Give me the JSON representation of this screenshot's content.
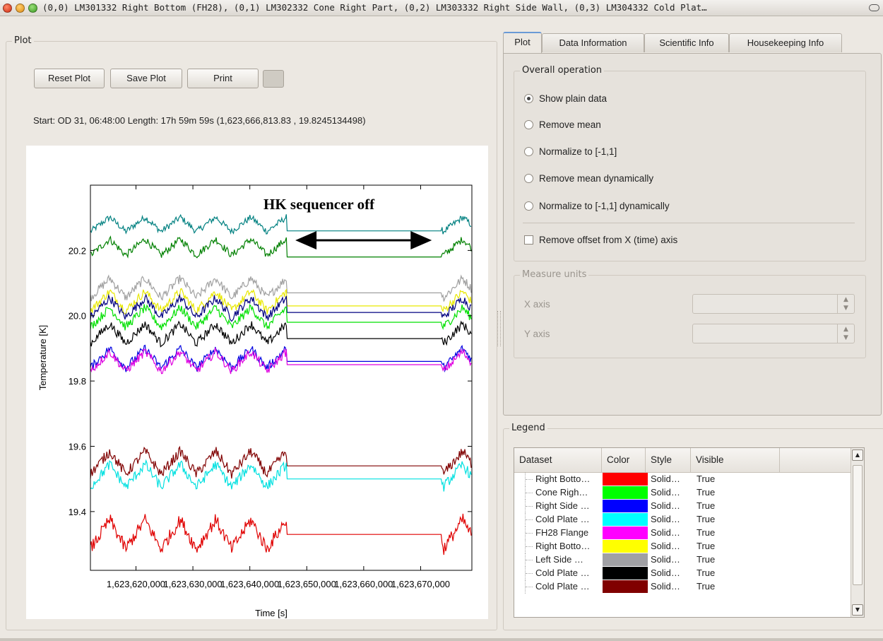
{
  "window": {
    "title": "(0,0) LM301332 Right Bottom (FH28), (0,1) LM302332 Cone Right Part, (0,2) LM303332 Right Side Wall, (0,3) LM304332 Cold Plat…"
  },
  "plot_group": {
    "title": "Plot",
    "buttons": {
      "reset": "Reset Plot",
      "save": "Save Plot",
      "print": "Print"
    },
    "info": "Start: OD 31, 06:48:00  Length: 17h 59m 59s  (1,623,666,813.83 , 19.8245134498)"
  },
  "chart_data": {
    "type": "line",
    "xlabel": "Time [s]",
    "ylabel": "Temperature [K]",
    "xlim": [
      1623612000,
      1623679000
    ],
    "ylim": [
      19.22,
      20.4
    ],
    "x_ticks": [
      1623620000,
      1623630000,
      1623640000,
      1623650000,
      1623660000,
      1623670000
    ],
    "x_tick_labels": [
      "1,623,620,000",
      "1,623,630,000",
      "1,623,640,000",
      "1,623,650,000",
      "1,623,660,000",
      "1,623,670,000"
    ],
    "y_ticks": [
      19.4,
      19.6,
      19.8,
      20.0,
      20.2
    ],
    "y_tick_labels": [
      "19.4",
      "19.6",
      "19.8",
      "20.0",
      "20.2"
    ],
    "gap": [
      1623646500,
      1623673700
    ],
    "annotation": "HK sequencer off",
    "series": [
      {
        "color": "#008080",
        "flat_value": 20.26,
        "amp": 0.022,
        "tilt": 0.02
      },
      {
        "color": "#008000",
        "flat_value": 20.18,
        "amp": 0.025,
        "tilt": 0.03
      },
      {
        "color": "#a0a0a0",
        "flat_value": 20.07,
        "amp": 0.03,
        "tilt": 0.015
      },
      {
        "color": "#e8e800",
        "flat_value": 20.03,
        "amp": 0.03,
        "tilt": 0.015
      },
      {
        "color": "#000080",
        "flat_value": 20.01,
        "amp": 0.03,
        "tilt": 0.015
      },
      {
        "color": "#00e000",
        "flat_value": 19.98,
        "amp": 0.03,
        "tilt": 0.015
      },
      {
        "color": "#000000",
        "flat_value": 19.93,
        "amp": 0.03,
        "tilt": 0.015
      },
      {
        "color": "#0000e0",
        "flat_value": 19.86,
        "amp": 0.03,
        "tilt": 0.01
      },
      {
        "color": "#e000e0",
        "flat_value": 19.85,
        "amp": 0.03,
        "tilt": 0.01
      },
      {
        "color": "#800000",
        "flat_value": 19.54,
        "amp": 0.035,
        "tilt": 0.01
      },
      {
        "color": "#00e0e0",
        "flat_value": 19.5,
        "amp": 0.035,
        "tilt": 0.01
      },
      {
        "color": "#e00000",
        "flat_value": 19.33,
        "amp": 0.045,
        "tilt": 0.0
      }
    ]
  },
  "tabs": [
    "Plot",
    "Data Information",
    "Scientific Info",
    "Housekeeping Info"
  ],
  "overall_operation": {
    "title": "Overall operation",
    "options": [
      "Show plain data",
      "Remove mean",
      "Normalize to [-1,1]",
      "Remove mean dynamically",
      "Normalize to [-1,1] dynamically"
    ],
    "selected": "Show plain data",
    "checkbox_label": "Remove offset from X (time) axis"
  },
  "measure_units": {
    "title": "Measure units",
    "x_label": "X axis",
    "y_label": "Y axis"
  },
  "legend": {
    "title": "Legend",
    "headers": [
      "Dataset",
      "Color",
      "Style",
      "Visible"
    ],
    "rows": [
      {
        "name": "Right Botto…",
        "color": "#ff0000",
        "style": "Solid…",
        "visible": "True"
      },
      {
        "name": "Cone Righ…",
        "color": "#00ff00",
        "style": "Solid…",
        "visible": "True"
      },
      {
        "name": "Right Side …",
        "color": "#0000ff",
        "style": "Solid…",
        "visible": "True"
      },
      {
        "name": "Cold Plate …",
        "color": "#00ffff",
        "style": "Solid…",
        "visible": "True"
      },
      {
        "name": "FH28 Flange",
        "color": "#ff00ff",
        "style": "Solid…",
        "visible": "True"
      },
      {
        "name": "Right Botto…",
        "color": "#ffff00",
        "style": "Solid…",
        "visible": "True"
      },
      {
        "name": "Left Side …",
        "color": "#a0a0a4",
        "style": "Solid…",
        "visible": "True"
      },
      {
        "name": "Cold Plate …",
        "color": "#000000",
        "style": "Solid…",
        "visible": "True"
      },
      {
        "name": "Cold Plate …",
        "color": "#800000",
        "style": "Solid…",
        "visible": "True"
      }
    ]
  }
}
